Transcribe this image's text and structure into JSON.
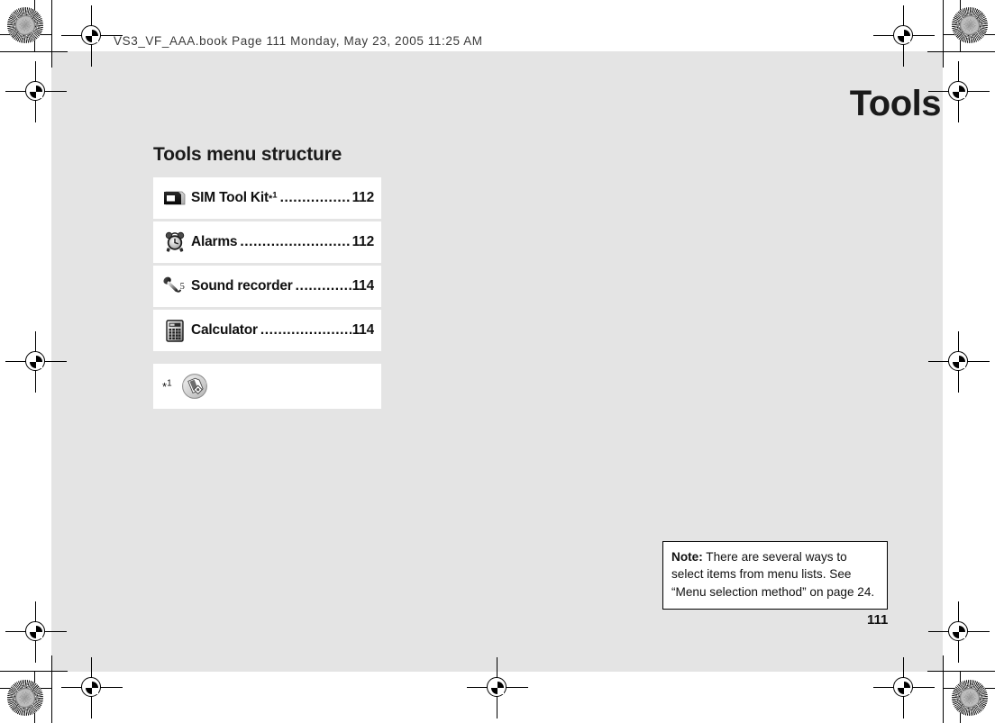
{
  "print_header": {
    "meta_line": "VS3_VF_AAA.book  Page 111  Monday,  May 23,  2005  11:25 AM"
  },
  "chapter": {
    "title": "Tools"
  },
  "section": {
    "heading": "Tools menu structure"
  },
  "menu": {
    "items": [
      {
        "icon": "sim-card-icon",
        "label": "SIM Tool Kit",
        "footnote_mark": "*",
        "footnote_sup": "1",
        "leader": "....................................................",
        "page": "112"
      },
      {
        "icon": "alarm-clock-icon",
        "label": "Alarms",
        "footnote_mark": "",
        "footnote_sup": "",
        "leader": "....................................................",
        "page": "112"
      },
      {
        "icon": "microphone-icon",
        "label": "Sound recorder",
        "footnote_mark": "",
        "footnote_sup": "",
        "leader": "....................................................",
        "page": "114"
      },
      {
        "icon": "calculator-icon",
        "label": "Calculator",
        "footnote_mark": "",
        "footnote_sup": "",
        "leader": "....................................................",
        "page": "114"
      }
    ],
    "footnote": {
      "mark": "*",
      "sup": "1",
      "icon": "usim-card-circle-icon"
    }
  },
  "note": {
    "label": "Note:",
    "text": " There are several ways to select items from menu lists. See “Menu selection method” on page 24."
  },
  "footer": {
    "page_number": "111"
  },
  "colors": {
    "page_background": "#e4e4e4",
    "card_background": "#ffffff",
    "text": "#111111",
    "bleed_background": "#ffffff"
  }
}
